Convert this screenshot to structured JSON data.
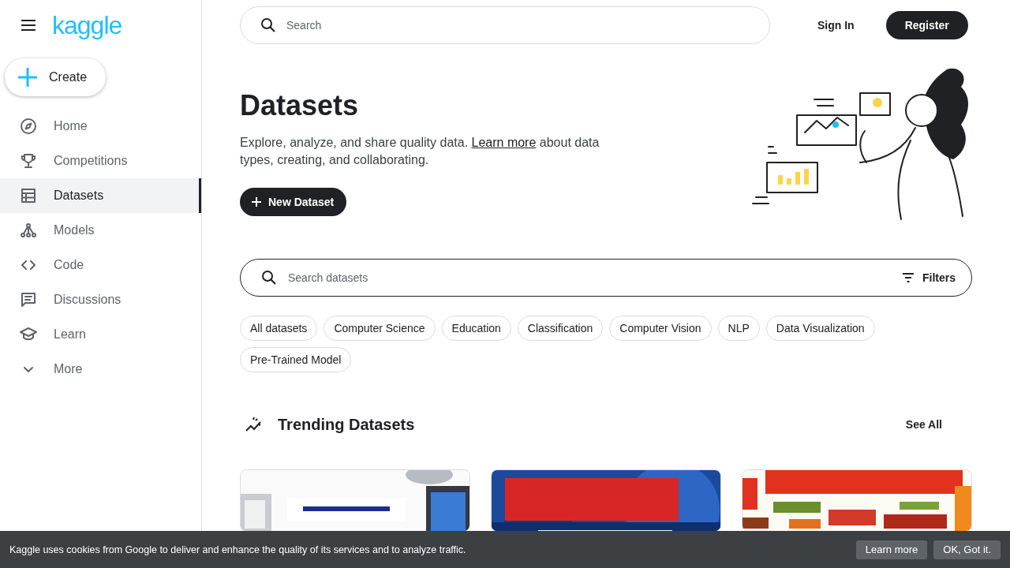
{
  "header": {
    "logo": "kaggle",
    "search_placeholder": "Search",
    "sign_in": "Sign In",
    "register": "Register"
  },
  "sidebar": {
    "create": "Create",
    "items": [
      {
        "label": "Home",
        "selected": false
      },
      {
        "label": "Competitions",
        "selected": false
      },
      {
        "label": "Datasets",
        "selected": true
      },
      {
        "label": "Models",
        "selected": false
      },
      {
        "label": "Code",
        "selected": false
      },
      {
        "label": "Discussions",
        "selected": false
      },
      {
        "label": "Learn",
        "selected": false
      },
      {
        "label": "More",
        "selected": false
      }
    ]
  },
  "hero": {
    "title": "Datasets",
    "link": "Learn more",
    "description_before": "Explore, analyze, and share quality data. ",
    "description_after": " about data types, creating, and collaborating.",
    "button": "New Dataset"
  },
  "dataset_search": {
    "placeholder": "Search datasets",
    "filters": "Filters"
  },
  "chips": [
    "All datasets",
    "Computer Science",
    "Education",
    "Classification",
    "Computer Vision",
    "NLP",
    "Data Visualization",
    "Pre-Trained Model"
  ],
  "trending": {
    "title": "Trending Datasets",
    "see_all": "See All"
  },
  "cookie_bar": {
    "message": "Kaggle uses cookies from Google to deliver and enhance the quality of its services and to analyze traffic.",
    "buttons": [
      "Learn more",
      "OK, Got it."
    ]
  }
}
